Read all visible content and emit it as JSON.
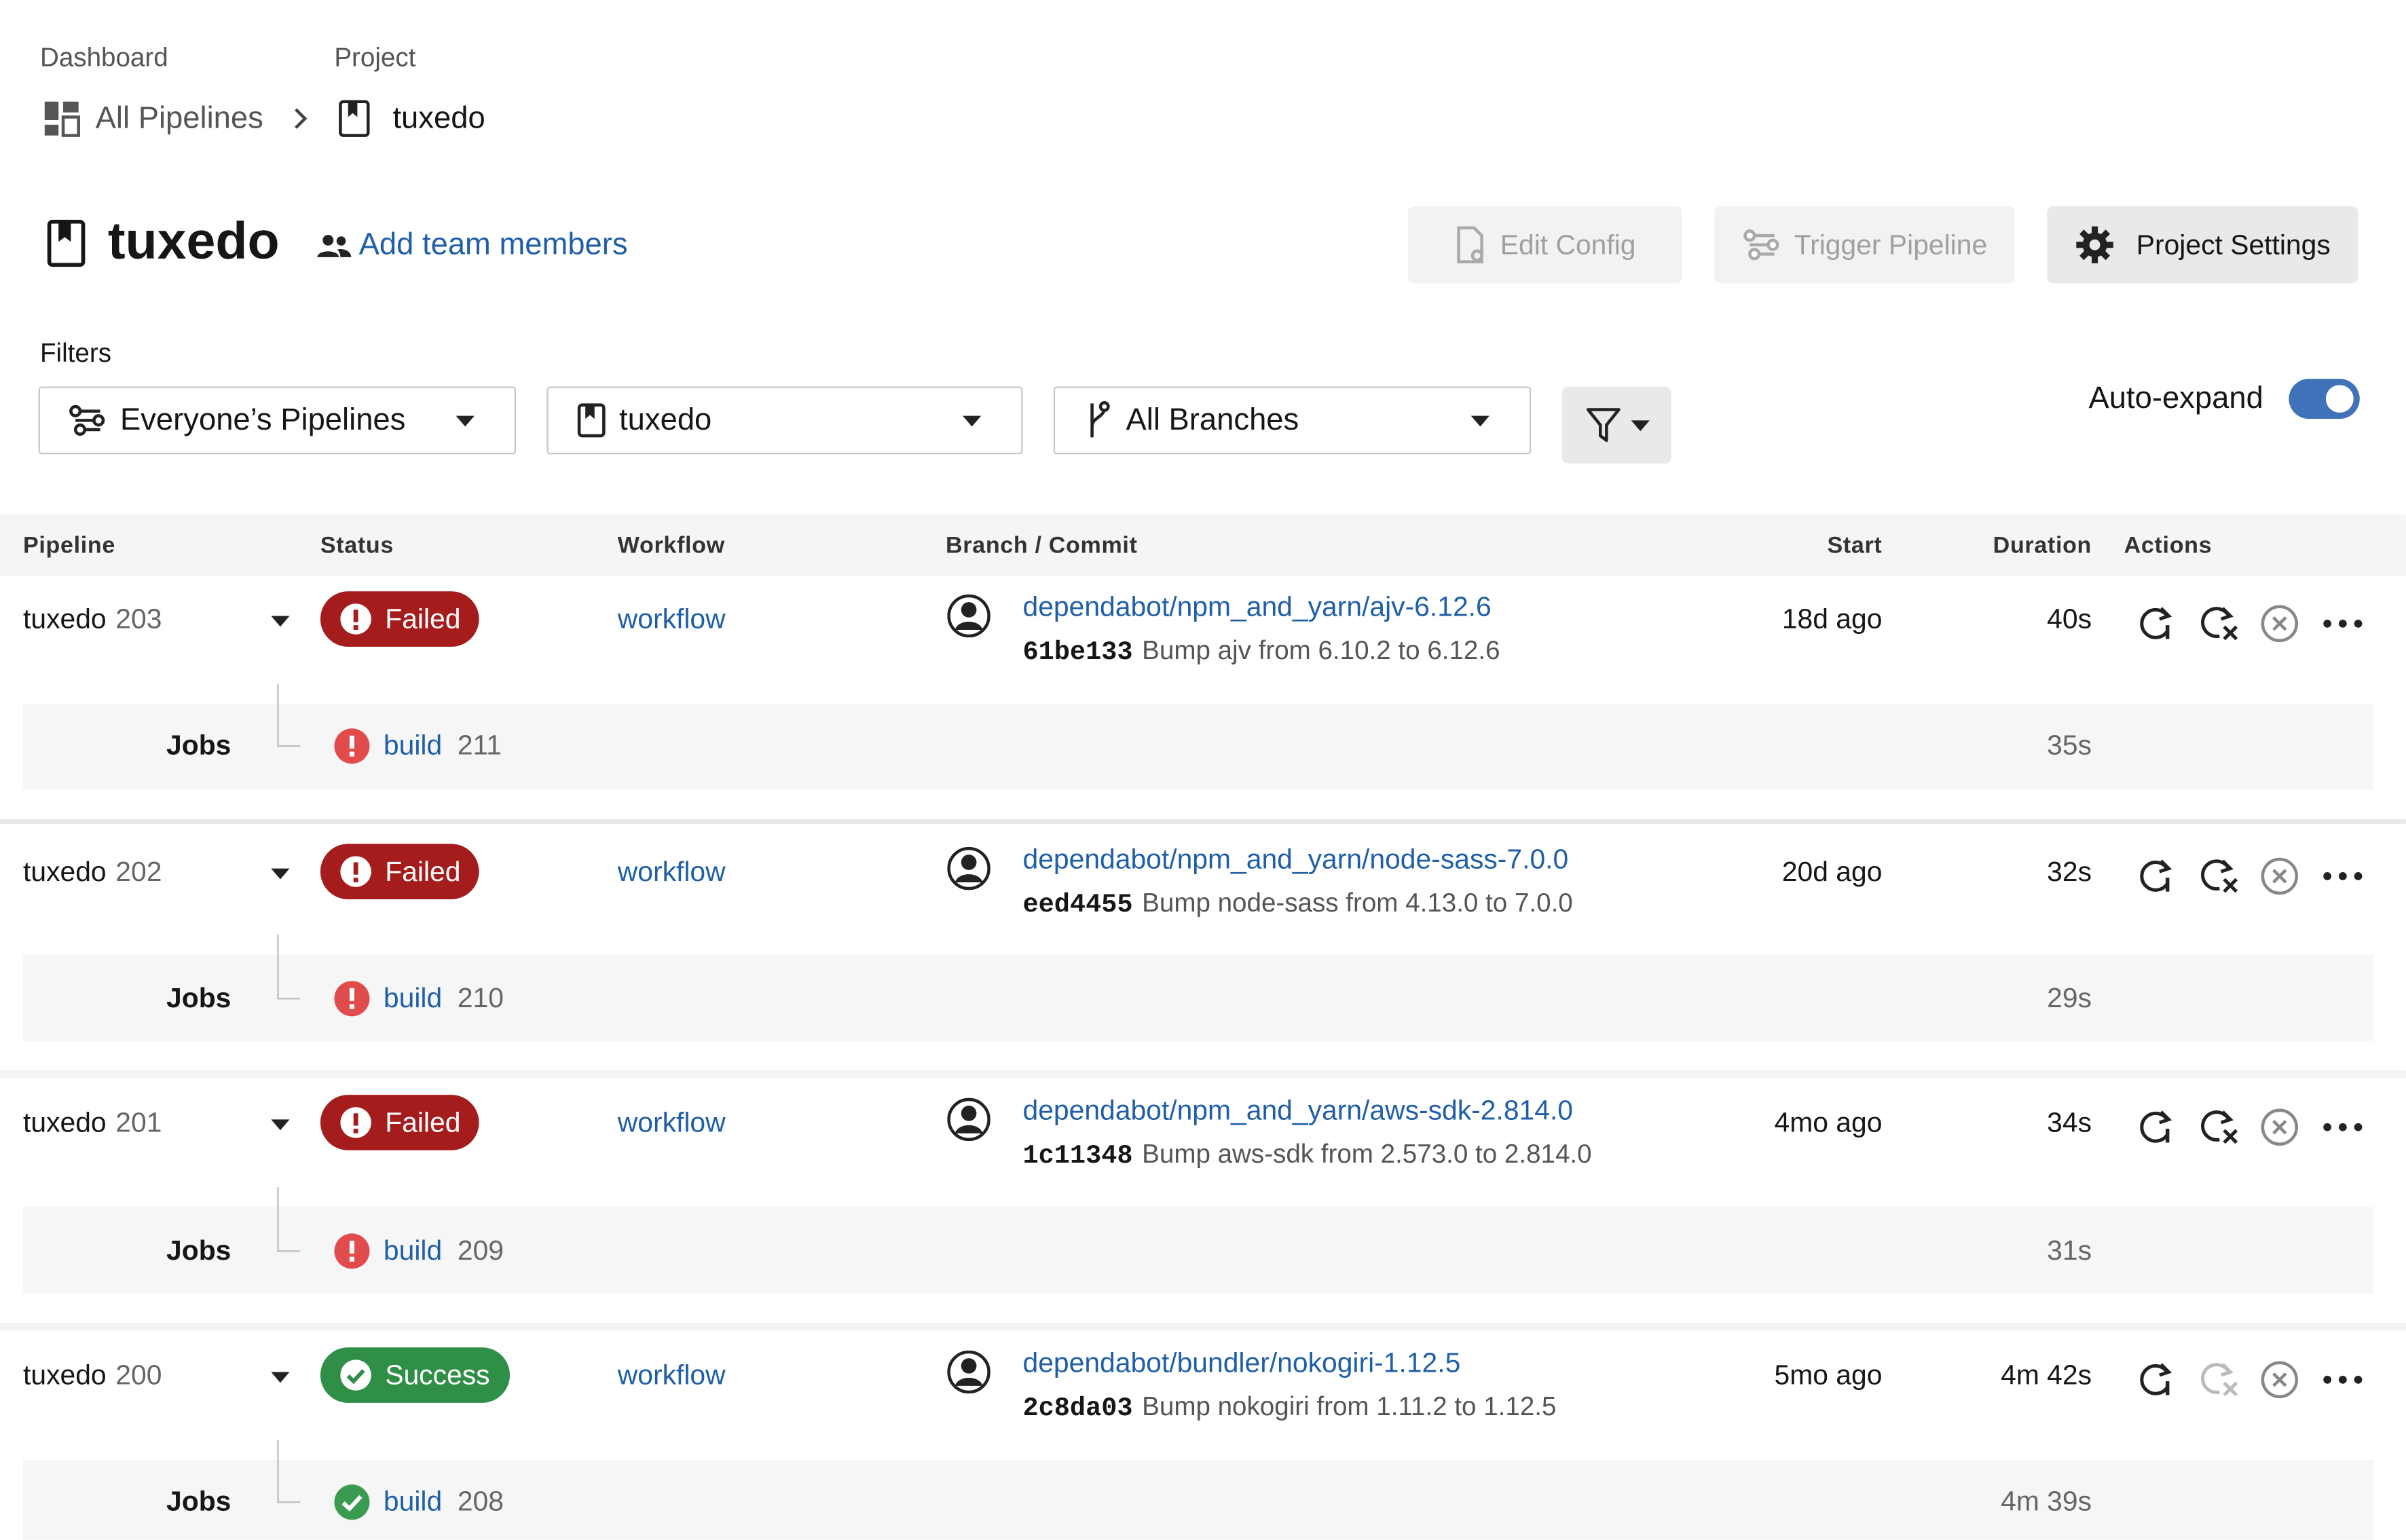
{
  "breadcrumb": {
    "dashboard_label": "Dashboard",
    "project_label": "Project",
    "all_pipelines": "All Pipelines",
    "project": "tuxedo"
  },
  "header": {
    "title": "tuxedo",
    "add_team": "Add team members",
    "edit_config": "Edit Config",
    "trigger_pipeline": "Trigger Pipeline",
    "project_settings": "Project Settings"
  },
  "filters": {
    "label": "Filters",
    "pipelines": "Everyone’s Pipelines",
    "project": "tuxedo",
    "branches": "All Branches",
    "auto_expand_label": "Auto-expand",
    "auto_expand": true
  },
  "table": {
    "headers": {
      "pipeline": "Pipeline",
      "status": "Status",
      "workflow": "Workflow",
      "branch_commit": "Branch / Commit",
      "start": "Start",
      "duration": "Duration",
      "actions": "Actions"
    },
    "jobs_label": "Jobs",
    "rows": [
      {
        "name": "tuxedo",
        "number": "203",
        "status": "Failed",
        "workflow": "workflow",
        "branch": "dependabot/npm_and_yarn/ajv-6.12.6",
        "sha": "61be133",
        "message": "Bump ajv from 6.10.2 to 6.12.6",
        "start": "18d ago",
        "duration": "40s",
        "job": {
          "name": "build",
          "number": "211",
          "duration": "35s",
          "status": "failed"
        }
      },
      {
        "name": "tuxedo",
        "number": "202",
        "status": "Failed",
        "workflow": "workflow",
        "branch": "dependabot/npm_and_yarn/node-sass-7.0.0",
        "sha": "eed4455",
        "message": "Bump node-sass from 4.13.0 to 7.0.0",
        "start": "20d ago",
        "duration": "32s",
        "job": {
          "name": "build",
          "number": "210",
          "duration": "29s",
          "status": "failed"
        }
      },
      {
        "name": "tuxedo",
        "number": "201",
        "status": "Failed",
        "workflow": "workflow",
        "branch": "dependabot/npm_and_yarn/aws-sdk-2.814.0",
        "sha": "1c11348",
        "message": "Bump aws-sdk from 2.573.0 to 2.814.0",
        "start": "4mo ago",
        "duration": "34s",
        "job": {
          "name": "build",
          "number": "209",
          "duration": "31s",
          "status": "failed"
        }
      },
      {
        "name": "tuxedo",
        "number": "200",
        "status": "Success",
        "workflow": "workflow",
        "branch": "dependabot/bundler/nokogiri-1.12.5",
        "sha": "2c8da03",
        "message": "Bump nokogiri from 1.11.2 to 1.12.5",
        "start": "5mo ago",
        "duration": "4m 42s",
        "job": {
          "name": "build",
          "number": "208",
          "duration": "4m 39s",
          "status": "success"
        }
      }
    ]
  },
  "colors": {
    "link": "#1f5fa8",
    "failed": "#a51c1c",
    "success": "#2f8f46",
    "toggle": "#3f72b8"
  }
}
